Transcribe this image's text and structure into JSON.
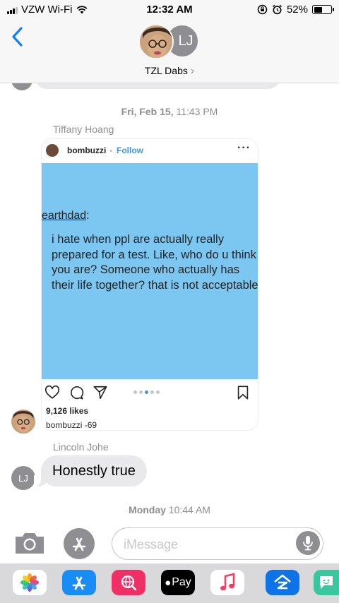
{
  "status_bar": {
    "carrier": "VZW Wi-Fi",
    "time": "12:32 AM",
    "battery_percent": "52%",
    "battery_level": 0.52
  },
  "header": {
    "contact_initials": "LJ",
    "group_name": "TZL Dabs",
    "chevron": "›"
  },
  "thread": {
    "timestamp_1": {
      "day": "Fri, Feb 15,",
      "time": " 11:43 PM"
    },
    "sender_1": "Tiffany Hoang",
    "instagram": {
      "username": "bombuzzi",
      "separator": "·",
      "follow_label": "Follow",
      "more": "···",
      "post_handle": "earthdad",
      "post_handle_suffix": ":",
      "post_text": "i hate when ppl are actually really prepared for a test. Like, who do u think you are? Someone who actually has their life together? that is not acceptable",
      "likes": "9,126 likes",
      "caption_user": "bombuzzi",
      "caption_text": " -69"
    },
    "sender_2": "Lincoln Johe",
    "lj_initials": "LJ",
    "message_2": "Honestly true",
    "timestamp_2": {
      "day": "Monday",
      "time": " 10:44 AM"
    }
  },
  "compose": {
    "placeholder": "iMessage"
  },
  "app_drawer": {
    "apple_pay_label": "Pay",
    "icons": [
      "photos-icon",
      "app-store-icon",
      "web-search-icon",
      "apple-pay-icon",
      "music-icon",
      "zillow-icon",
      "bitmoji-icon"
    ]
  },
  "colors": {
    "ios_blue": "#147efb",
    "bubble_gray": "#e9e9eb",
    "post_background": "#7cc6f2",
    "instagram_blue": "#3897f0"
  }
}
